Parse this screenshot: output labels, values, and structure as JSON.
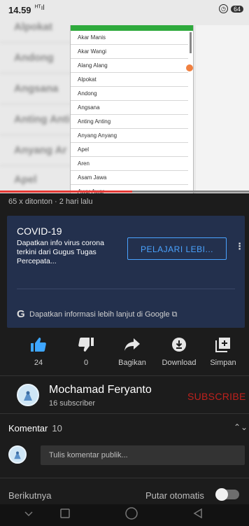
{
  "status_bar": {
    "time": "14.59",
    "signal": "ᴴᵀıl",
    "battery": "64"
  },
  "video": {
    "background_items": [
      "Alpokat",
      "Andong",
      "Angsana",
      "Anting Anti",
      "Anyang Ar",
      "Apel"
    ],
    "dropdown_items": [
      "Akar Manis",
      "Akar Wangi",
      "Alang Alang",
      "Alpokat",
      "Andong",
      "Angsana",
      "Anting Anting",
      "Anyang Anyang",
      "Apel",
      "Aren",
      "Asam Jawa",
      "Awar Awar"
    ],
    "progress": 0.53
  },
  "meta": {
    "views": "65 x ditonton · 2 hari lalu"
  },
  "info_card": {
    "title": "COVID-19",
    "description": "Dapatkan info virus corona terkini dari Gugus Tugas Percepata...",
    "button": "PELAJARI LEBI...",
    "google_link": "Dapatkan informasi lebih lanjut di Google",
    "bg_color": "#23304d",
    "accent": "#4aa3ff"
  },
  "actions": [
    {
      "icon": "thumbs-up-icon",
      "label": "24"
    },
    {
      "icon": "thumbs-down-icon",
      "label": "0"
    },
    {
      "icon": "share-icon",
      "label": "Bagikan"
    },
    {
      "icon": "download-icon",
      "label": "Download"
    },
    {
      "icon": "add-to-playlist-icon",
      "label": "Simpan"
    }
  ],
  "channel": {
    "name": "Mochamad Feryanto",
    "subscribers": "16 subscriber",
    "subscribe_label": "SUBSCRIBE",
    "subscribe_color": "#c0211c"
  },
  "comments": {
    "label": "Komentar",
    "count": "10",
    "placeholder": "Tulis komentar publik..."
  },
  "up_next": {
    "label": "Berikutnya",
    "autoplay_label": "Putar otomatis"
  }
}
